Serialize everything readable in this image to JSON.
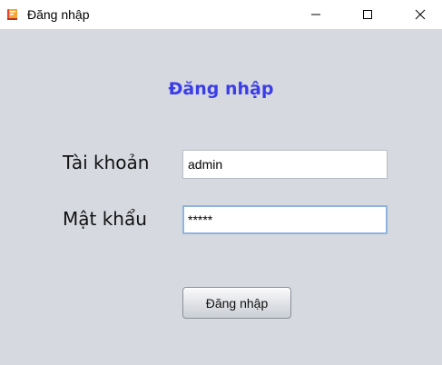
{
  "window": {
    "title": "Đăng nhập",
    "icon": "app-book-icon",
    "controls": {
      "minimize_icon": "minimize-icon",
      "maximize_icon": "maximize-icon",
      "close_icon": "close-icon"
    }
  },
  "form": {
    "heading": "Đăng nhập",
    "username_label": "Tài khoản",
    "username_value": "admin",
    "password_label": "Mật khẩu",
    "password_value": "*****",
    "submit_label": "Đăng nhập"
  },
  "colors": {
    "background": "#d6d9e0",
    "heading": "#3b3de8",
    "focus_border": "#8fb4de"
  }
}
